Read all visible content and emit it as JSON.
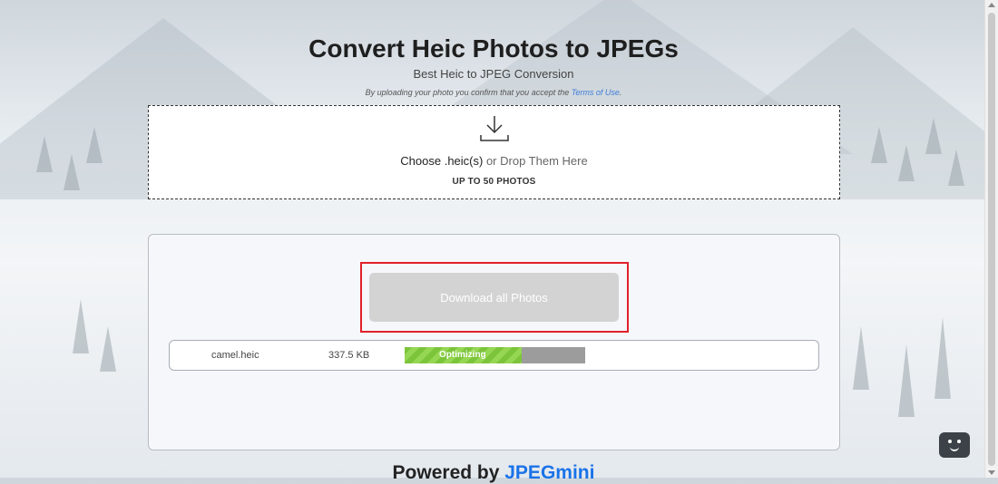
{
  "header": {
    "title": "Convert Heic Photos to JPEGs",
    "subtitle": "Best Heic to JPEG Conversion",
    "terms_prefix": "By uploading your photo you confirm that you accept the ",
    "terms_link": "Terms of Use",
    "terms_suffix": "."
  },
  "dropzone": {
    "icon": "download-icon",
    "choose_label": "Choose .heic(s)",
    "drop_label": " or Drop Them Here",
    "limit_label": "UP TO 50 PHOTOS"
  },
  "results": {
    "download_all_label": "Download all Photos",
    "files": [
      {
        "name": "camel.heic",
        "size": "337.5 KB",
        "status": "Optimizing",
        "progress": 0.65
      }
    ]
  },
  "footer": {
    "powered_prefix": "Powered by ",
    "brand": "JPEGmini"
  },
  "chat": {
    "icon": "chat-face-icon"
  },
  "colors": {
    "accent": "#1a73e8",
    "highlight": "#e0202a",
    "progress_green": "#7cc43a"
  }
}
